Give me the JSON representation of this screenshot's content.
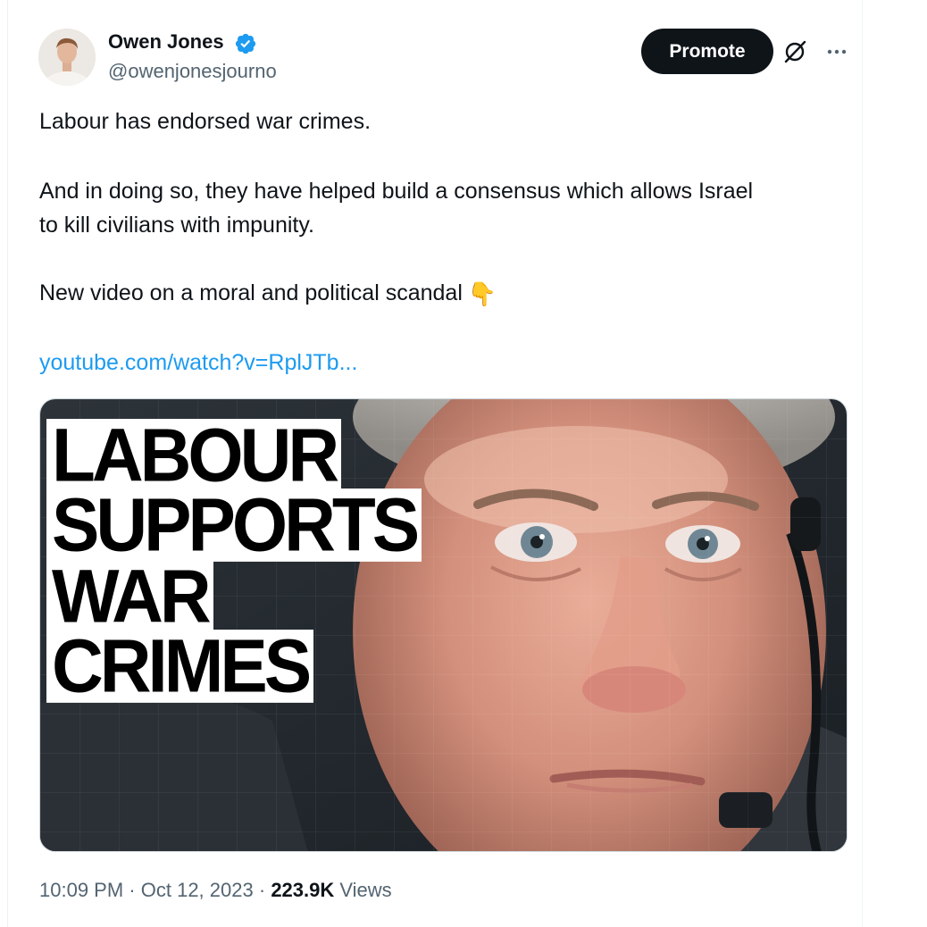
{
  "author": {
    "name": "Owen Jones",
    "handle": "@owenjonesjourno",
    "verified": true,
    "verified_color": "#1d9bf0"
  },
  "actions": {
    "promote_label": "Promote",
    "grok_icon": "grok-slash-icon",
    "more_icon": "more-horizontal-icon"
  },
  "tweet": {
    "line1": "Labour has endorsed war crimes.",
    "line2": "And in doing so, they have helped build a consensus which allows Israel",
    "line3": "to kill civilians with impunity.",
    "line4": "New video on a moral and political scandal",
    "emoji": "👇",
    "link": "youtube.com/watch?v=RplJTb..."
  },
  "media": {
    "headline_lines": [
      "LABOUR",
      "SUPPORTS",
      "WAR",
      "CRIMES"
    ]
  },
  "meta": {
    "time": "10:09 PM",
    "separator": "·",
    "date": "Oct 12, 2023",
    "views_count": "223.9K",
    "views_label": "Views"
  },
  "colors": {
    "text": "#0f1419",
    "secondary": "#536471",
    "link": "#1d9bf0",
    "button_bg": "#0f1419"
  }
}
